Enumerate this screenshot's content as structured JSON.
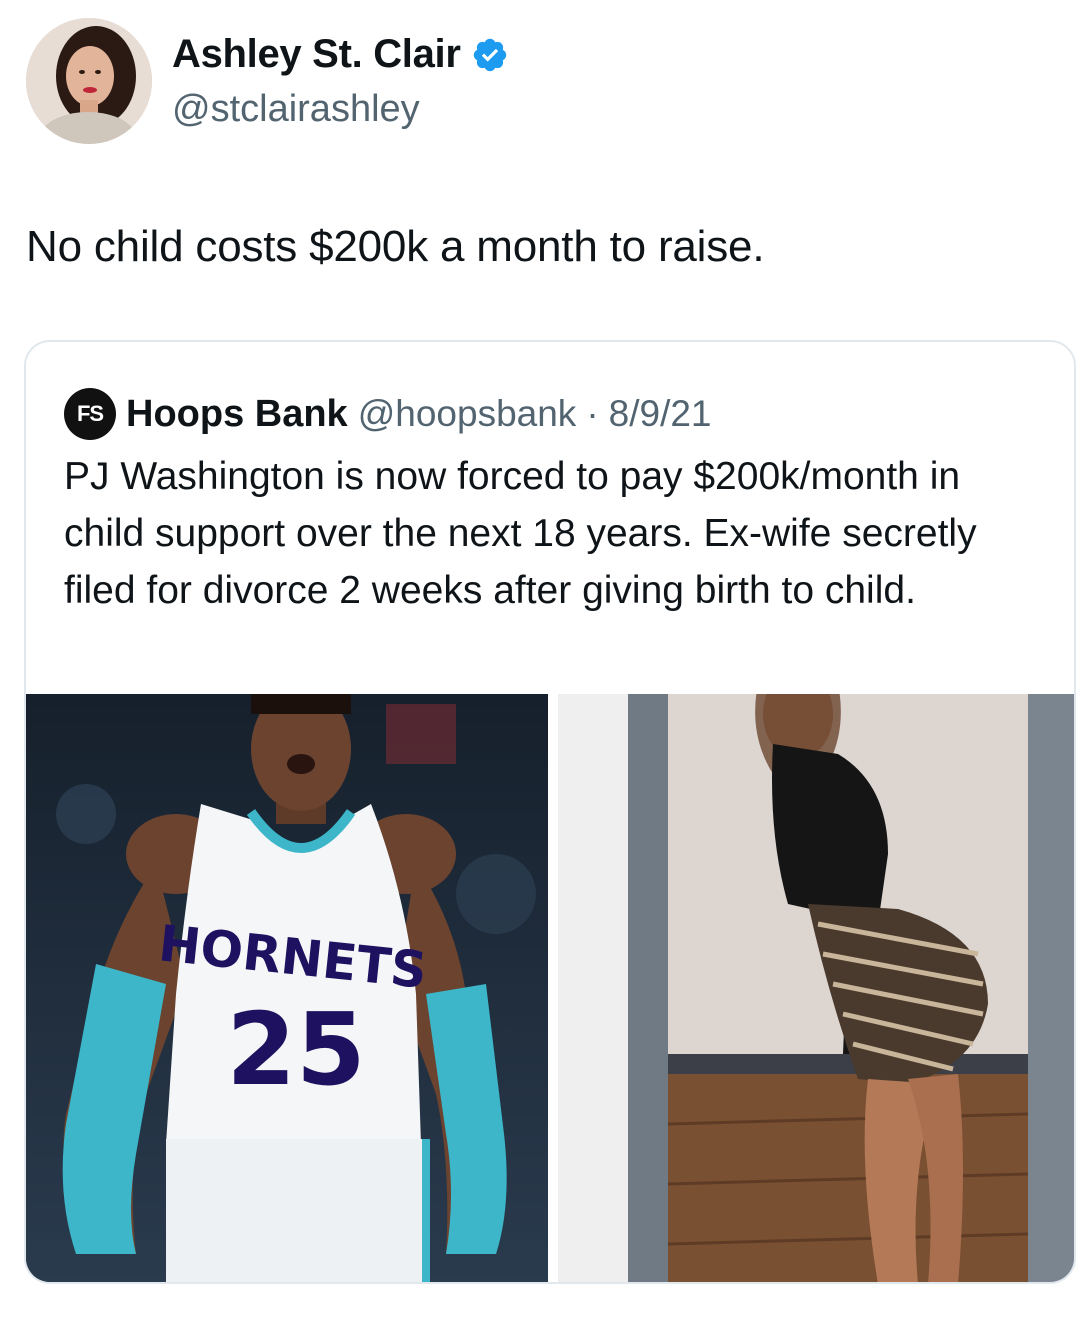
{
  "tweet": {
    "author": {
      "name": "Ashley St. Clair",
      "handle": "@stclairashley",
      "verified": true
    },
    "text": "No child costs $200k a month to raise."
  },
  "quoted_tweet": {
    "avatar_initials": "FS",
    "author_name": "Hoops Bank",
    "handle": "@hoopsbank",
    "separator": "·",
    "date": "8/9/21",
    "text": "PJ Washington is now forced to pay $200k/month in child support over the next 18 years. Ex-wife secretly filed for divorce 2 weeks after giving birth to child.",
    "media": [
      {
        "jersey_team": "HORNETS",
        "jersey_number": "25"
      },
      {}
    ]
  },
  "colors": {
    "verified_blue": "#1d9bf0",
    "text_primary": "#0f1419",
    "text_secondary": "#536471",
    "border": "#e1e8ed",
    "hornets_teal": "#3cb6c8",
    "hornets_navy": "#1d1160"
  },
  "icons": {
    "verified": "verified-badge-icon"
  }
}
